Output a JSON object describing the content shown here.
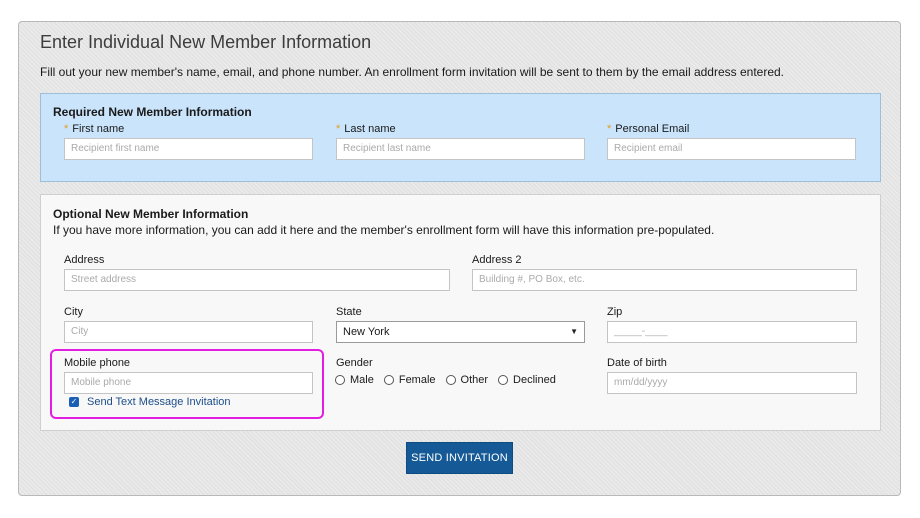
{
  "page": {
    "title": "Enter Individual New Member Information",
    "description": "Fill out your new member's name, email, and phone number. An enrollment form invitation will be sent to them by the email address entered."
  },
  "required": {
    "title": "Required New Member Information",
    "first_name": {
      "label": "First name",
      "placeholder": "Recipient first name"
    },
    "last_name": {
      "label": "Last name",
      "placeholder": "Recipient last name"
    },
    "email": {
      "label": "Personal Email",
      "placeholder": "Recipient email"
    },
    "required_marker": "*"
  },
  "optional": {
    "title": "Optional New Member Information",
    "subtitle": "If you have more information, you can add it here and the member's enrollment form will have this information pre-populated.",
    "address": {
      "label": "Address",
      "placeholder": "Street address"
    },
    "address2": {
      "label": "Address 2",
      "placeholder": "Building #, PO Box, etc."
    },
    "city": {
      "label": "City",
      "placeholder": "City"
    },
    "state": {
      "label": "State",
      "value": "New York"
    },
    "zip": {
      "label": "Zip",
      "placeholder": "_____-____"
    },
    "mobile": {
      "label": "Mobile phone",
      "placeholder": "Mobile phone"
    },
    "gender": {
      "label": "Gender",
      "options": [
        "Male",
        "Female",
        "Other",
        "Declined"
      ]
    },
    "dob": {
      "label": "Date of birth",
      "placeholder": "mm/dd/yyyy"
    },
    "text_invite": {
      "label": "Send Text Message Invitation",
      "checked": true
    }
  },
  "actions": {
    "send_label": "SEND INVITATION"
  },
  "colors": {
    "required_bg": "#c9e4fb",
    "button_bg": "#155a96",
    "highlight": "#e21fe0",
    "star": "#e79a1f"
  }
}
